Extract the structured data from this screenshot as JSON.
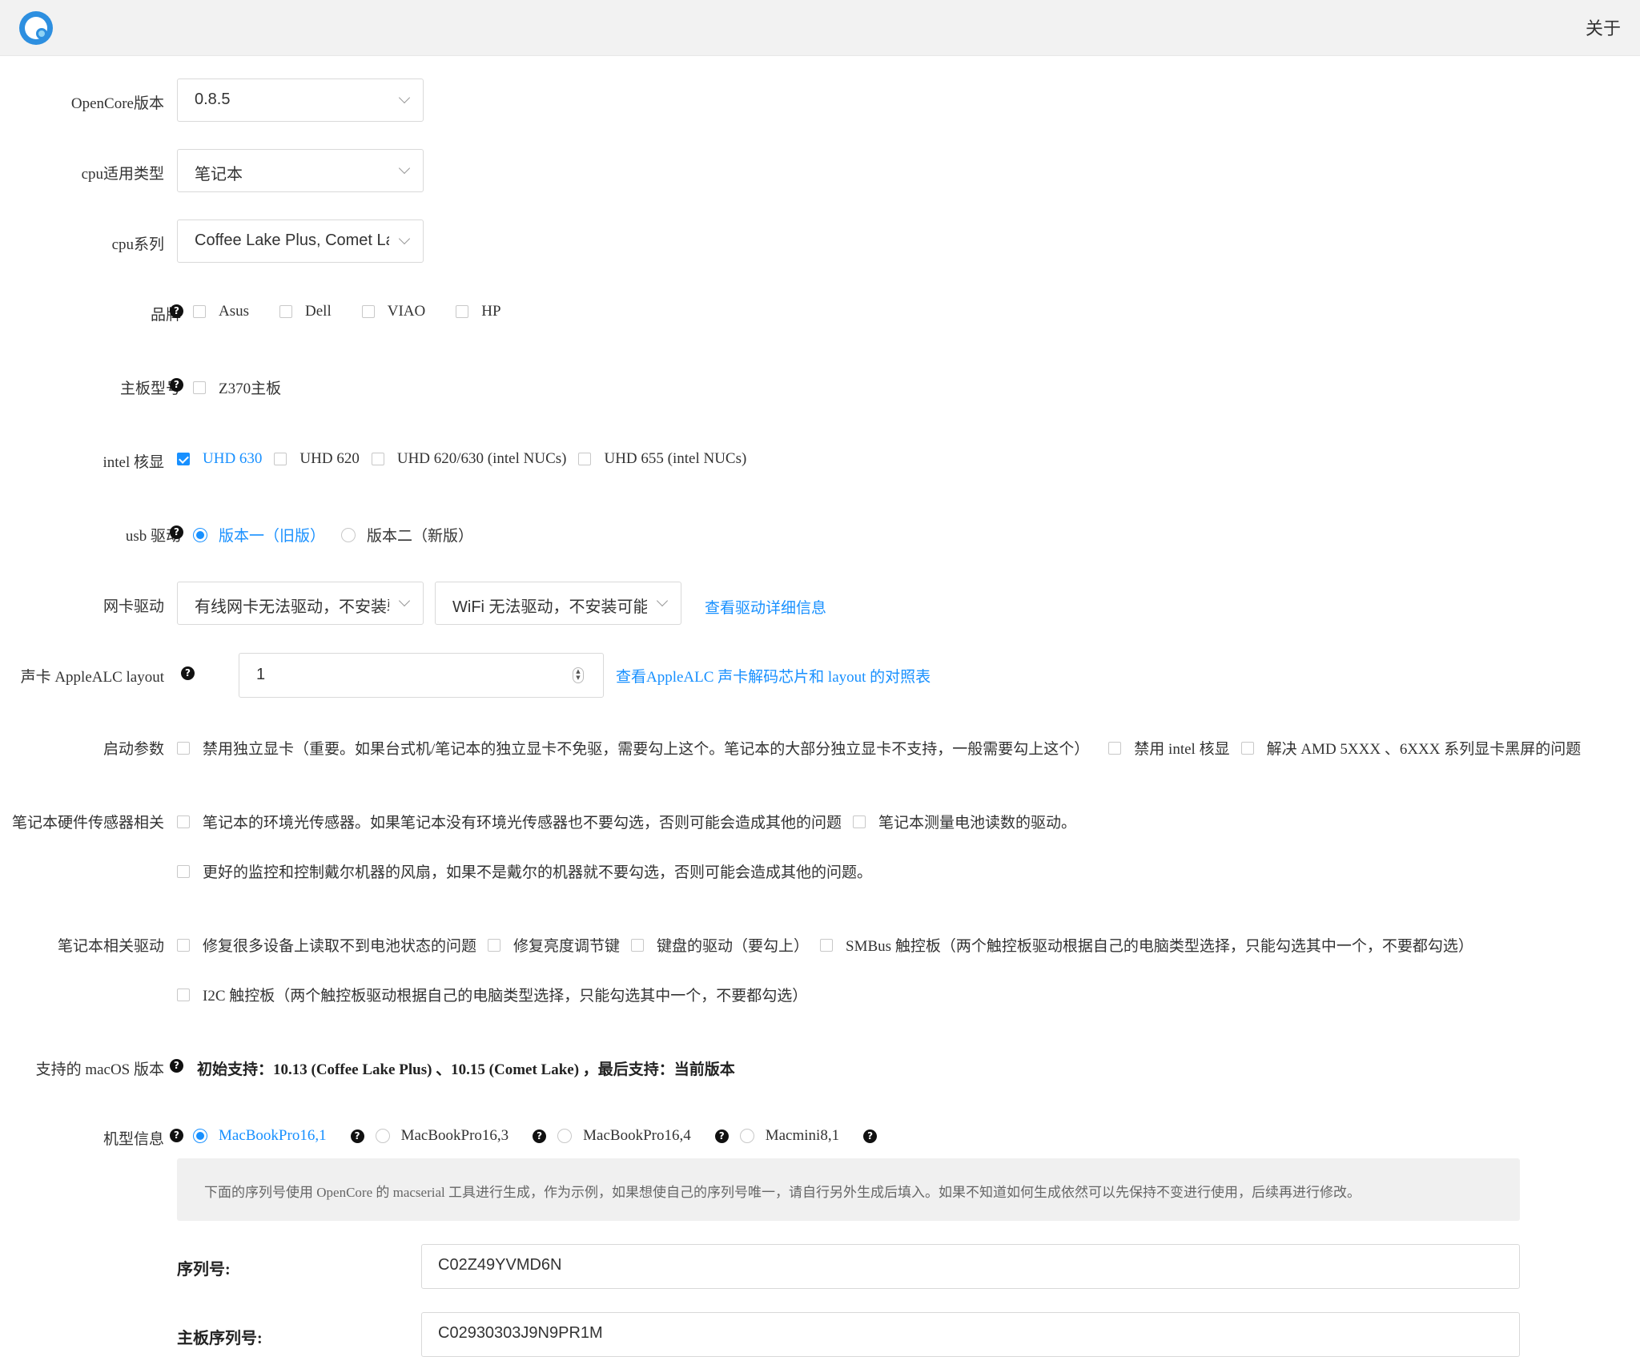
{
  "header": {
    "about": "关于"
  },
  "labels": {
    "opencore": "OpenCore版本",
    "cpu_type": "cpu适用类型",
    "cpu_series": "cpu系列",
    "brand": "品牌",
    "board": "主板型号",
    "igpu": "intel 核显",
    "usb": "usb 驱动",
    "nic": "网卡驱动",
    "audio": "声卡 AppleALC layout",
    "boot": "启动参数",
    "sensors": "笔记本硬件传感器相关",
    "laptop_drivers": "笔记本相关驱动",
    "macos": "支持的 macOS 版本",
    "model": "机型信息"
  },
  "selects": {
    "opencore": "0.8.5",
    "cpu_type": "笔记本",
    "cpu_series": "Coffee Lake Plus, Comet Lake",
    "wired": "有线网卡无法驱动，不安装驱动",
    "wifi": "WiFi 无法驱动，不安装可能"
  },
  "brands": [
    "Asus",
    "Dell",
    "VIAO",
    "HP"
  ],
  "board_options": [
    "Z370主板"
  ],
  "igpu_options": [
    "UHD 630",
    "UHD 620",
    "UHD 620/630 (intel NUCs)",
    "UHD 655 (intel NUCs)"
  ],
  "usb_options": [
    "版本一（旧版）",
    "版本二（新版）"
  ],
  "links": {
    "driver_details": "查看驱动详细信息",
    "alc_table": "查看AppleALC 声卡解码芯片和 layout 的对照表"
  },
  "audio_layout": "1",
  "boot_options": [
    "禁用独立显卡（重要。如果台式机/笔记本的独立显卡不免驱，需要勾上这个。笔记本的大部分独立显卡不支持，一般需要勾上这个）",
    "禁用 intel 核显",
    "解决 AMD 5XXX 、6XXX 系列显卡黑屏的问题"
  ],
  "sensor_options": [
    "笔记本的环境光传感器。如果笔记本没有环境光传感器也不要勾选，否则可能会造成其他的问题",
    "笔记本测量电池读数的驱动。",
    "更好的监控和控制戴尔机器的风扇，如果不是戴尔的机器就不要勾选，否则可能会造成其他的问题。"
  ],
  "laptop_driver_options": [
    "修复很多设备上读取不到电池状态的问题",
    "修复亮度调节键",
    "键盘的驱动（要勾上）",
    "SMBus 触控板（两个触控板驱动根据自己的电脑类型选择，只能勾选其中一个，不要都勾选）",
    "I2C 触控板（两个触控板驱动根据自己的电脑类型选择，只能勾选其中一个，不要都勾选）"
  ],
  "macos_support": "初始支持：10.13 (Coffee Lake Plus) 、10.15 (Comet Lake) ，最后支持：当前版本",
  "models": [
    "MacBookPro16,1",
    "MacBookPro16,3",
    "MacBookPro16,4",
    "Macmini8,1"
  ],
  "notice": "下面的序列号使用 OpenCore 的 macserial 工具进行生成，作为示例，如果想使自己的序列号唯一，请自行另外生成后填入。如果不知道如何生成依然可以先保持不变进行使用，后续再进行修改。",
  "serial": {
    "label": "序列号:",
    "value": "C02Z49YVMD6N"
  },
  "board_serial": {
    "label": "主板序列号:",
    "value": "C02930303J9N9PR1M"
  },
  "colors": {
    "accent": "#1890ff",
    "header_bg": "#f2f2f2",
    "notice_bg": "#f0f0f0"
  }
}
